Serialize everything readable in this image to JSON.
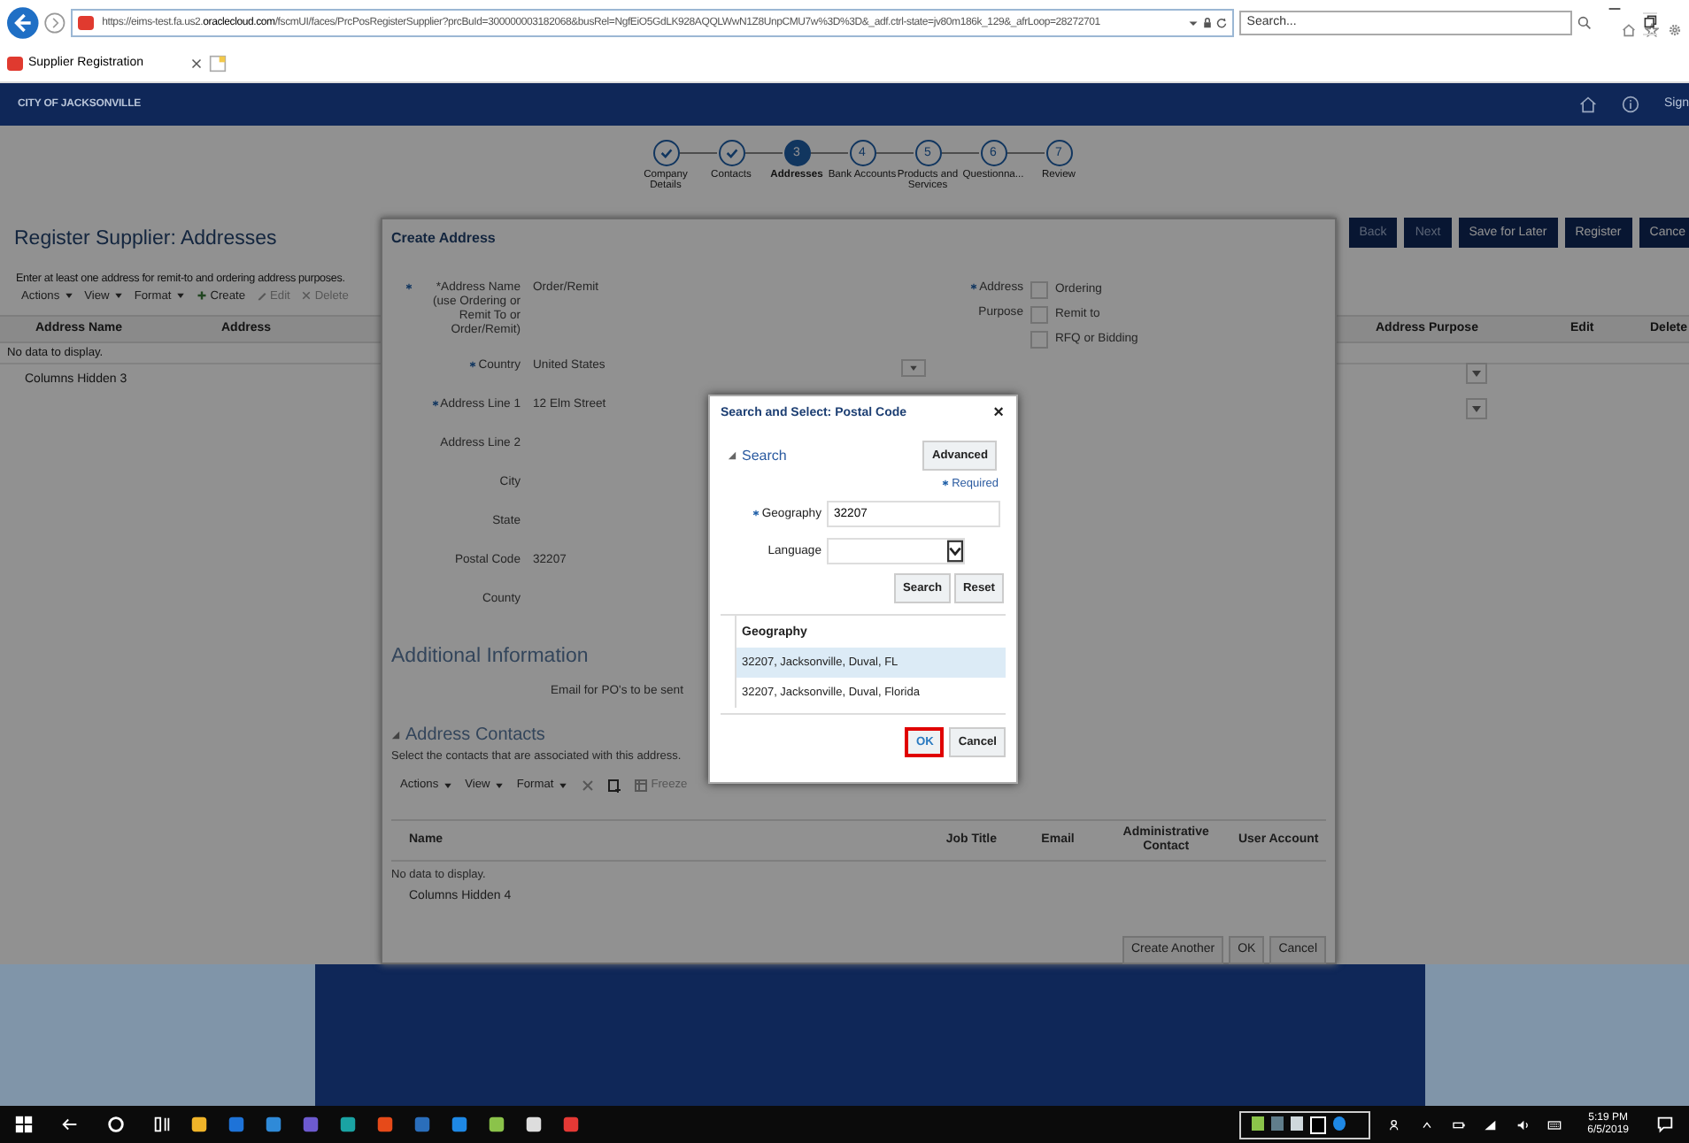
{
  "browser": {
    "url": "https://eims-test.fa.us2.**oraclecloud.com**/fscmUI/faces/PrcPosRegisterSupplier?prcBuId=300000003182068&busRel=NgfEiO5GdLK928AQQLWwN1Z8UnpCMU7w%3D%3D&_adf.ctrl-state=jv80m186k_129&_afrLoop=28272701",
    "search_placeholder": "Search...",
    "tab_title": "Supplier Registration"
  },
  "header": {
    "brand": "CITY OF JACKSONVILLE",
    "sign_in": "Sign"
  },
  "train": [
    {
      "label": "Company Details",
      "completed": true,
      "selected": false
    },
    {
      "label": "Contacts",
      "completed": true,
      "selected": false
    },
    {
      "number": "3",
      "label": "Addresses",
      "completed": false,
      "selected": true
    },
    {
      "number": "4",
      "label": "Bank Accounts",
      "completed": false,
      "selected": false
    },
    {
      "number": "5",
      "label": "Products and Services",
      "completed": false,
      "selected": false
    },
    {
      "number": "6",
      "label": "Questionna...",
      "completed": false,
      "selected": false
    },
    {
      "number": "7",
      "label": "Review",
      "completed": false,
      "selected": false
    }
  ],
  "page": {
    "title": "Register Supplier: Addresses",
    "instruction": "Enter at least one address for remit-to and ordering address purposes.",
    "buttons": [
      {
        "label": "Back",
        "disabled": true
      },
      {
        "label": "Next",
        "disabled": true
      },
      {
        "label": "Save for Later",
        "disabled": false
      },
      {
        "label": "Register",
        "disabled": false
      },
      {
        "label": "Cance",
        "disabled": false
      }
    ],
    "toolbar": [
      {
        "kind": "menu",
        "label": "Actions",
        "disabled": false
      },
      {
        "kind": "menu",
        "label": "View",
        "disabled": false
      },
      {
        "kind": "menu",
        "label": "Format",
        "disabled": false
      },
      {
        "kind": "create",
        "label": "Create",
        "disabled": false
      },
      {
        "kind": "edit",
        "label": "Edit",
        "disabled": true
      },
      {
        "kind": "delete",
        "label": "Delete",
        "disabled": true
      }
    ],
    "table": {
      "columns": [
        "Address Name",
        "Address",
        "Address Purpose",
        "Edit",
        "Delete"
      ],
      "empty_text": "No data to display.",
      "columns_hidden": "Columns Hidden  3"
    }
  },
  "create_address": {
    "title": "Create Address",
    "fields": [
      {
        "kind": "text",
        "label": "*Address Name (use Ordering or Remit To or Order/Remit)",
        "required": true,
        "value": "Order/Remit"
      },
      {
        "kind": "select",
        "label": "Country",
        "required": true,
        "value": "United States"
      },
      {
        "kind": "text",
        "label": "Address Line 1",
        "required": true,
        "value": "12 Elm Street"
      },
      {
        "kind": "text",
        "label": "Address Line 2",
        "required": false
      },
      {
        "kind": "text",
        "label": "City",
        "required": false
      },
      {
        "kind": "text",
        "label": "State",
        "required": false
      },
      {
        "kind": "text",
        "label": "Postal Code",
        "required": false,
        "value": "32207"
      },
      {
        "kind": "text",
        "label": "County",
        "required": false
      }
    ],
    "purpose": {
      "label_1": "Address",
      "label_2": "Purpose",
      "required": true,
      "options": [
        {
          "label": "Ordering",
          "checked": false
        },
        {
          "label": "Remit to",
          "checked": false
        },
        {
          "label": "RFQ or Bidding",
          "checked": false
        }
      ]
    },
    "additional_heading": "Additional Information",
    "email_label": "Email for PO's to be sent",
    "contacts": {
      "heading": "Address Contacts",
      "instruction": "Select the contacts that are associated with this address.",
      "toolbar": [
        {
          "kind": "menu",
          "label": "Actions",
          "disabled": false
        },
        {
          "kind": "menu",
          "label": "View",
          "disabled": false
        },
        {
          "kind": "menu",
          "label": "Format",
          "disabled": false
        },
        {
          "kind": "delete",
          "disabled": true
        },
        {
          "kind": "add",
          "disabled": false
        },
        {
          "kind": "freeze",
          "label": "Freeze",
          "disabled": true
        }
      ],
      "columns": [
        "Name",
        "Job Title",
        "Email",
        "Administrative Contact",
        "User Account"
      ],
      "empty_text": "No data to display.",
      "columns_hidden": "Columns Hidden  4"
    },
    "buttons": [
      "Create Another",
      "OK",
      "Cancel"
    ]
  },
  "search_dialog": {
    "title": "Search and Select: Postal Code",
    "close": "×",
    "section": "Search",
    "advanced": "Advanced",
    "required_note": "Required",
    "geography_label": "Geography",
    "geography_value": "32207",
    "language_label": "Language",
    "buttons": [
      "Search",
      "Reset"
    ],
    "results_header": "Geography",
    "results": [
      {
        "text": "32207, Jacksonville, Duval, FL",
        "selected": true
      },
      {
        "text": "32207, Jacksonville, Duval, Florida",
        "selected": false
      }
    ],
    "ok": "OK",
    "cancel": "Cancel"
  },
  "taskbar": {
    "time": "5:19 PM",
    "date": "6/5/2019"
  }
}
